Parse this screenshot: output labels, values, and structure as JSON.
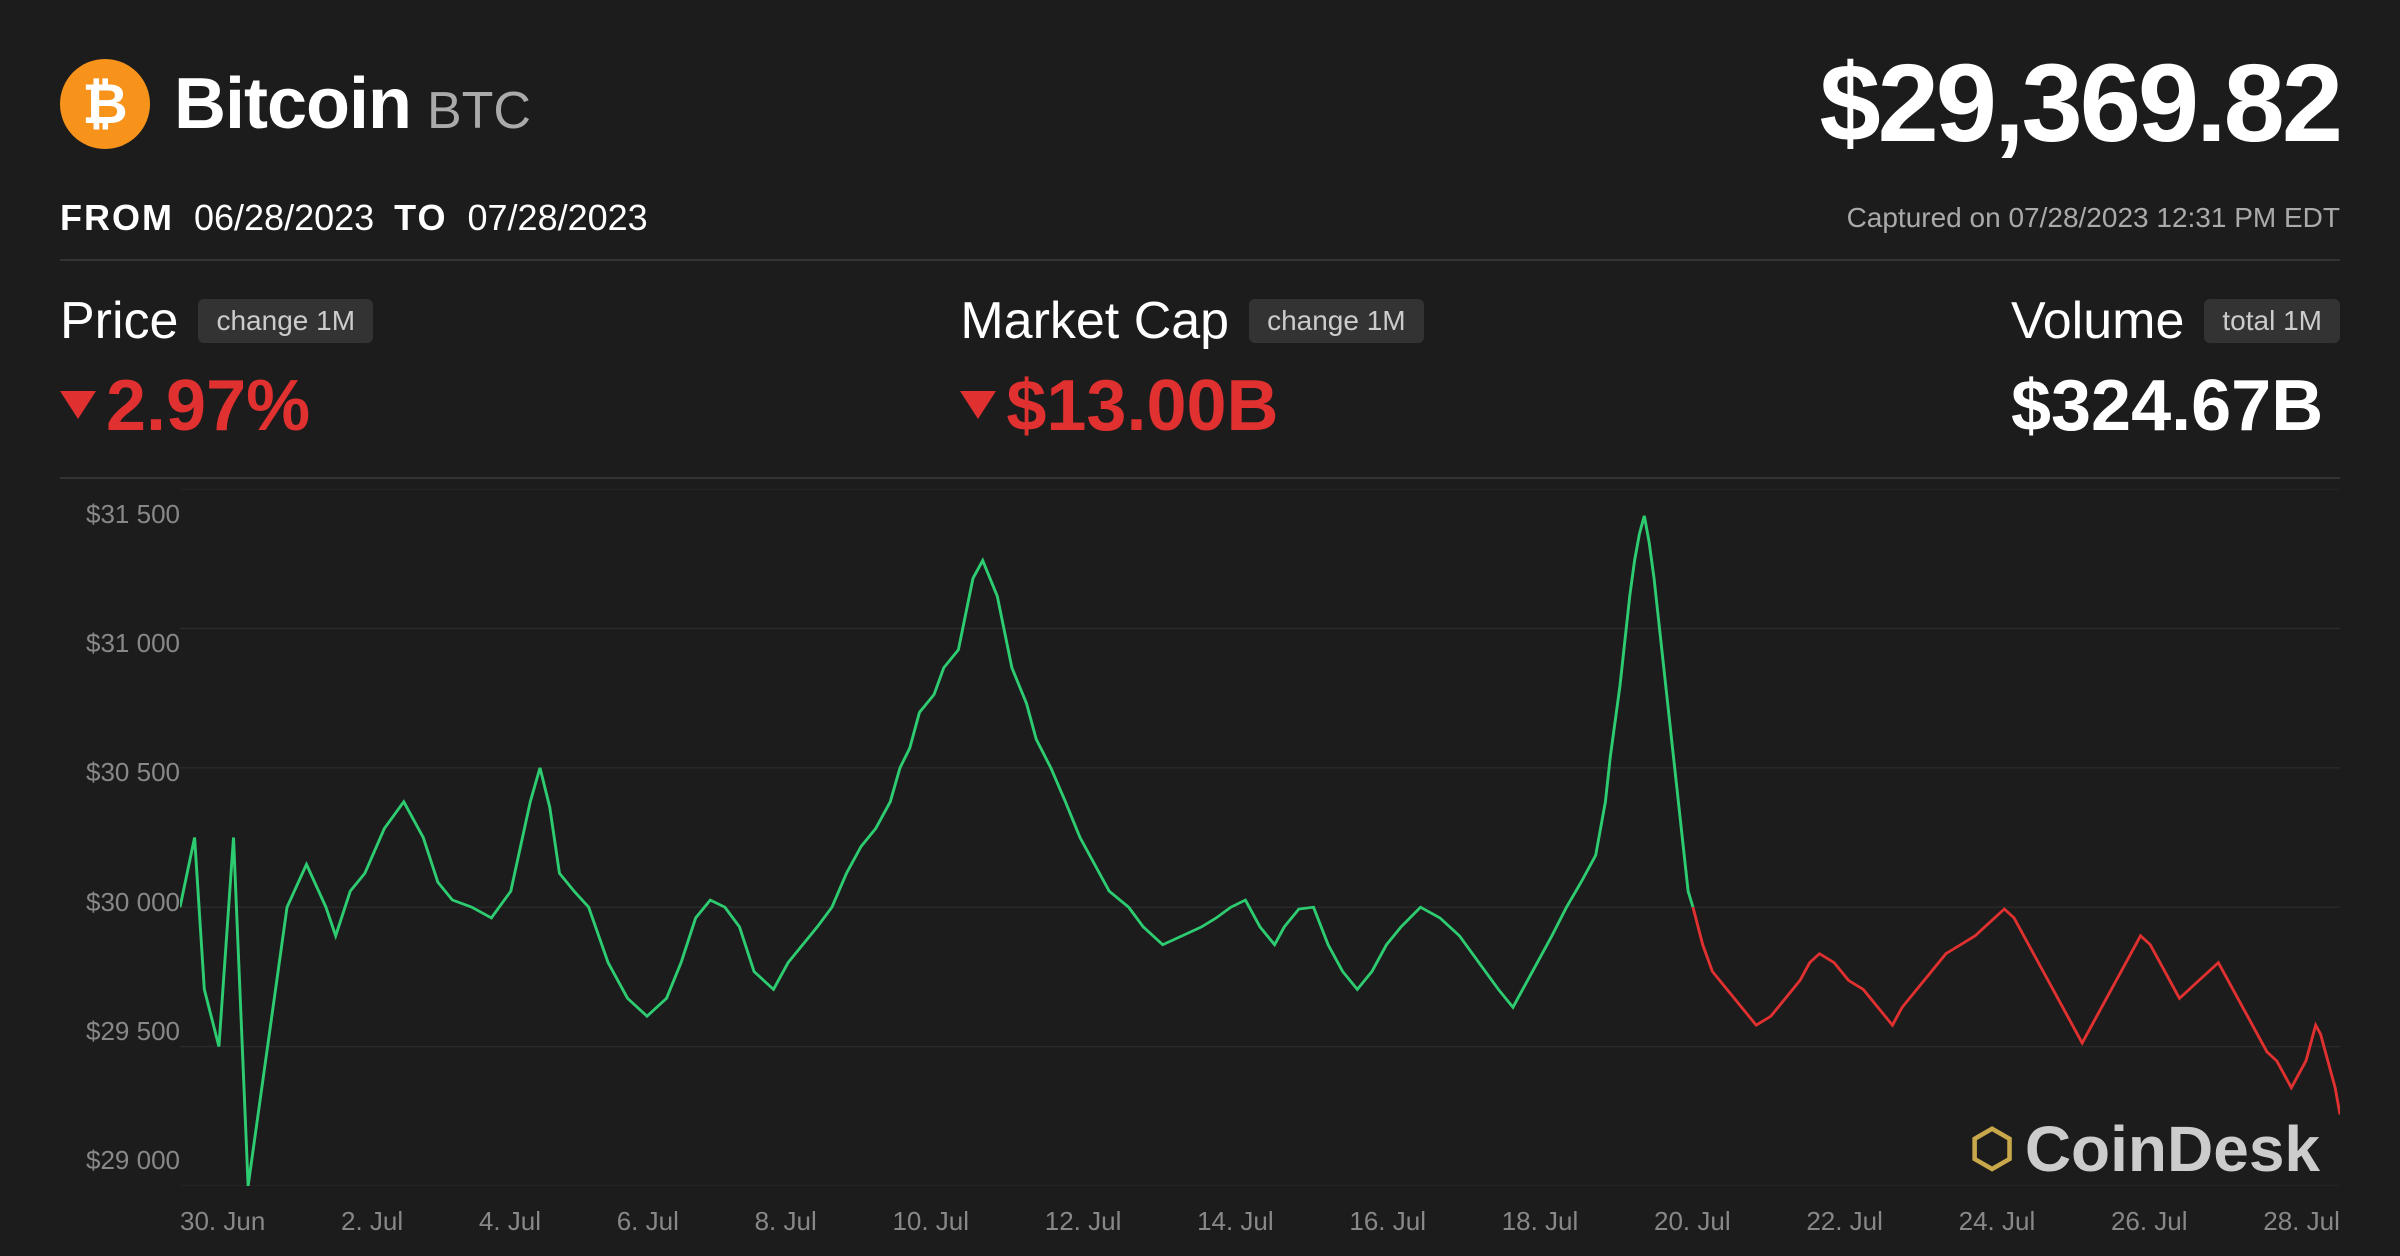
{
  "header": {
    "coin_name": "Bitcoin",
    "coin_ticker": "BTC",
    "current_price": "$29,369.82",
    "logo_symbol": "₿"
  },
  "dates": {
    "from_label": "FROM",
    "from_value": "06/28/2023",
    "to_label": "TO",
    "to_value": "07/28/2023",
    "capture_text": "Captured on 07/28/2023 12:31 PM EDT"
  },
  "metrics": {
    "price": {
      "label": "Price",
      "badge": "change 1M",
      "value": "▾ 2.97%",
      "type": "negative"
    },
    "market_cap": {
      "label": "Market Cap",
      "badge": "change 1M",
      "value": "▾ $13.00B",
      "type": "negative"
    },
    "volume": {
      "label": "Volume",
      "badge": "total 1M",
      "value": "$324.67B",
      "type": "neutral"
    }
  },
  "chart": {
    "y_labels": [
      "$31 500",
      "$31 000",
      "$30 500",
      "$30 000",
      "$29 500",
      "$29 000"
    ],
    "x_labels": [
      "30. Jun",
      "2. Jul",
      "4. Jul",
      "6. Jul",
      "8. Jul",
      "10. Jul",
      "12. Jul",
      "14. Jul",
      "16. Jul",
      "18. Jul",
      "20. Jul",
      "22. Jul",
      "24. Jul",
      "26. Jul",
      "28. Jul"
    ]
  },
  "watermark": {
    "icon": "₿",
    "text": "CoinDesk"
  }
}
